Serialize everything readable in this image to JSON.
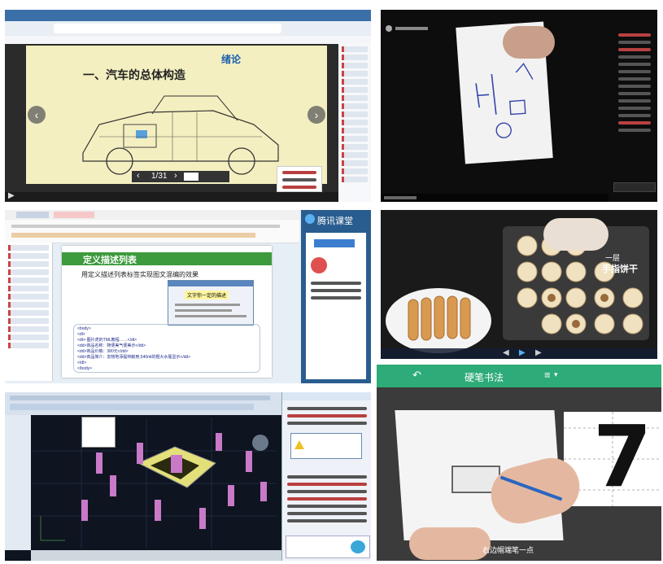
{
  "panel1": {
    "slide_title": "一、汽车的总体构造",
    "slide_tag": "绪论",
    "page_counter": "1/31",
    "colors": {
      "slide_bg": "#f4efc0",
      "browser_bg": "#2b2b2b",
      "accent": "#3a6fa8"
    }
  },
  "panel2": {
    "colors": {
      "bg": "#0d0d0d",
      "paper": "#f2f2f2"
    }
  },
  "panel3": {
    "brand": "腾讯课堂",
    "slide_title": "定义描述列表",
    "bullet": "用定义描述列表标签实现图文混编的效果",
    "popup_title": "文字你一定的描述",
    "code_lines": [
      "<body>",
      "<dl>",
      "<dt>·图片虎的TML教程……</dt>",
      "<dd>商品名称：随便美气便美示</dd>",
      "<dd>商品价格：380元</dd>",
      "<dd>商品简介：去物地添提林献用,540ml的粗大水瓶显示</dd>",
      "</dl>",
      "</body>"
    ],
    "colors": {
      "slide_head": "#3d9a3d",
      "bg": "#e6eef6",
      "side": "#2a5d8f"
    }
  },
  "panel4": {
    "caption_small": "一层",
    "caption": "手指饼干",
    "colors": {
      "bg": "#1a1a1a",
      "tray": "#3a3a3a"
    }
  },
  "panel5": {
    "colors": {
      "cad_bg": "#0e1420",
      "toolbar": "#d8e2ee",
      "chat_bg": "#eef2f8",
      "shape": "#e3e07a",
      "columns": "#c879c8"
    }
  },
  "panel6": {
    "header_title": "硬笔书法",
    "character": "7",
    "caption": "右边帽端笔一点",
    "colors": {
      "header": "#2dab78",
      "paper": "#ffffff",
      "bg": "#3b3b3b"
    }
  }
}
